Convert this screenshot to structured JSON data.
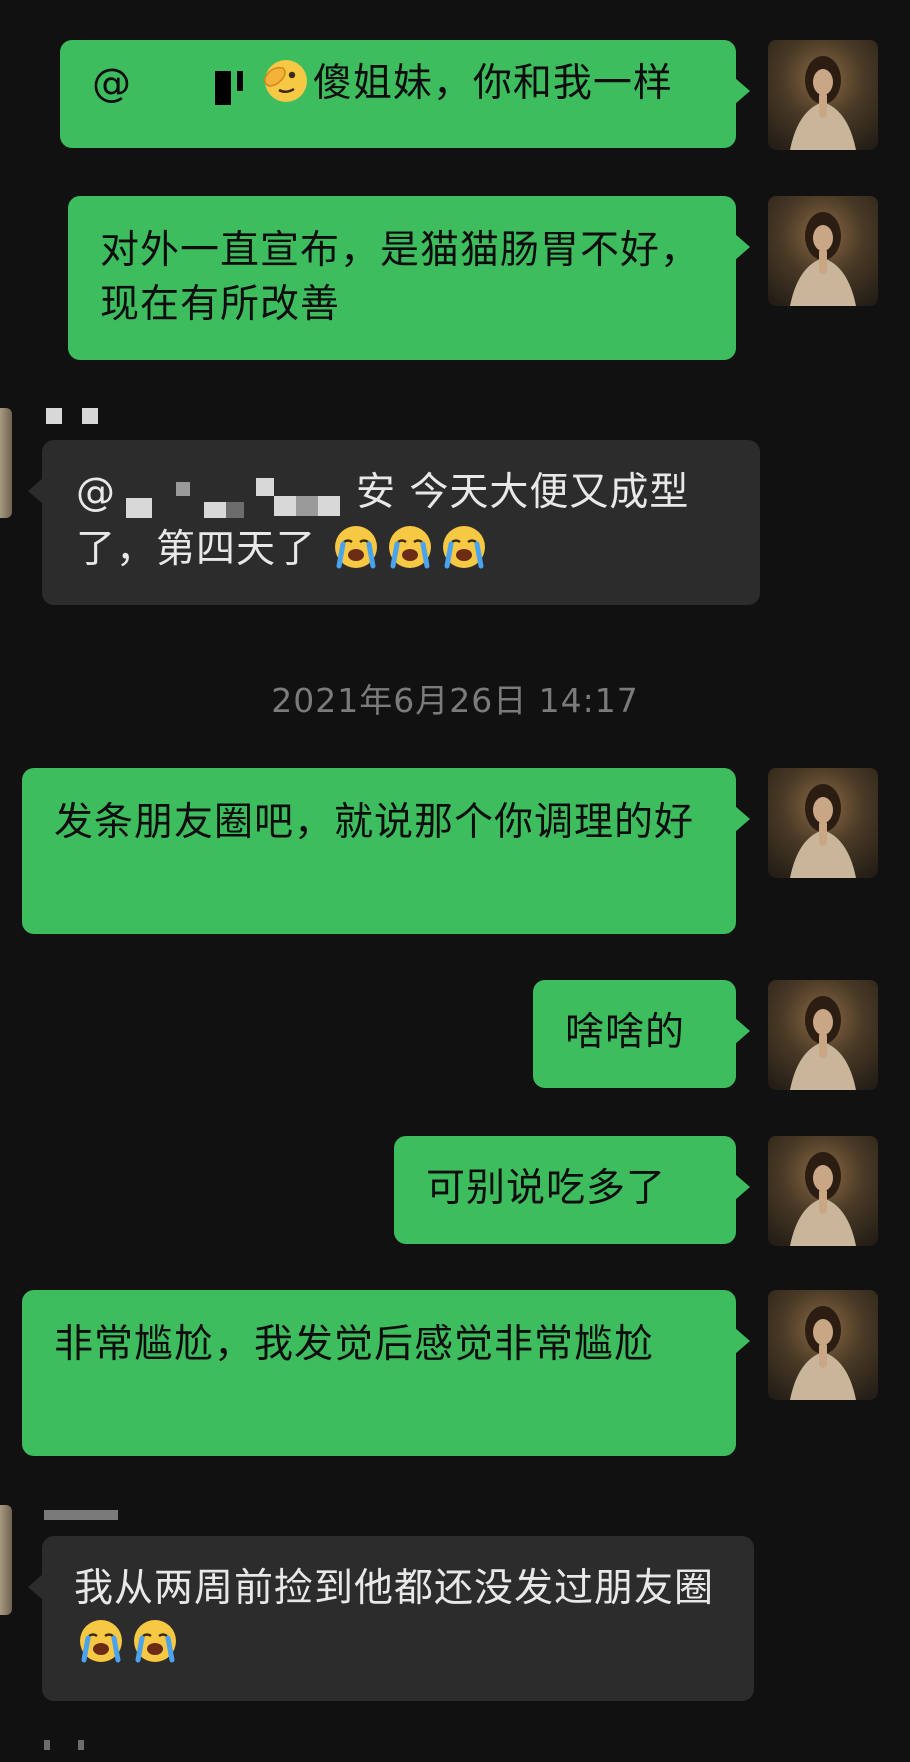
{
  "messages": [
    {
      "id": 1,
      "side": "right",
      "prefix": "@",
      "text": "傻姐妹，你和我一样",
      "emoji": "face-with-hand-over-eye"
    },
    {
      "id": 2,
      "side": "right",
      "text": "对外一直宣布，是猫猫肠胃不好，现在有所改善"
    },
    {
      "id": 3,
      "side": "left",
      "prefix": "@",
      "redacted_tail": "安",
      "text": " 今天大便又成型了，第四天了",
      "emoji_count": 3,
      "emoji": "loudly-crying-face"
    },
    {
      "id": 4,
      "side": "right",
      "text": "发条朋友圈吧，就说那个你调理的好"
    },
    {
      "id": 5,
      "side": "right",
      "text": "啥啥的"
    },
    {
      "id": 6,
      "side": "right",
      "text": "可别说吃多了"
    },
    {
      "id": 7,
      "side": "right",
      "text": "非常尴尬，我发觉后感觉非常尴尬"
    },
    {
      "id": 8,
      "side": "left",
      "text": "我从两周前捡到他都还没发过朋友圈",
      "emoji_count": 2,
      "emoji": "loudly-crying-face"
    }
  ],
  "timestamp": "2021年6月26日 14:17",
  "colors": {
    "background": "#111111",
    "outgoing_bubble": "#3ebd5e",
    "incoming_bubble": "#2c2c2c",
    "timestamp_text": "#7b7b7b"
  }
}
